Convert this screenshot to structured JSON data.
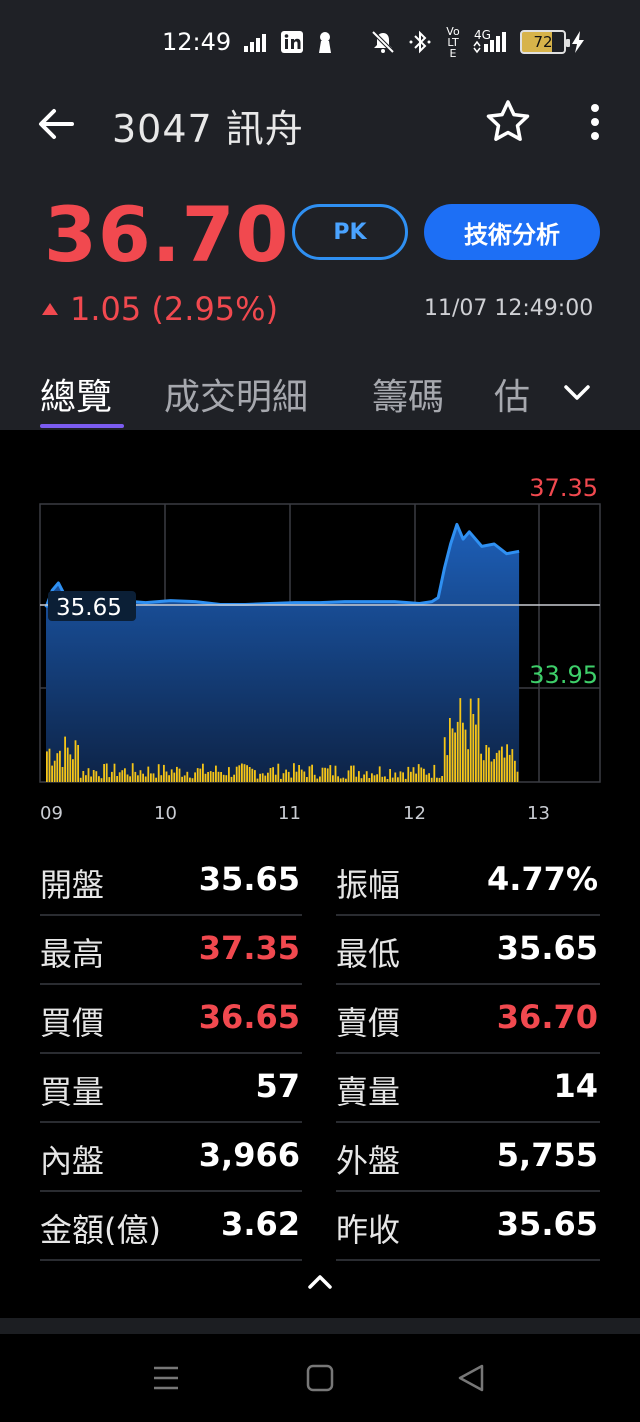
{
  "status_bar": {
    "time": "12:49",
    "battery": "72",
    "network": "4G",
    "volte": "Vo LTE"
  },
  "header": {
    "title": "3047 訊舟"
  },
  "quote": {
    "price": "36.70",
    "pk_label": "PK",
    "tech_label": "技術分析",
    "change": "1.05 (2.95%)",
    "datetime": "11/07 12:49:00"
  },
  "tabs": [
    "總覽",
    "成交明細",
    "籌碼",
    "估"
  ],
  "colors": {
    "up": "#f1494f",
    "down": "#3ecf6a",
    "accent": "#1d6ff5",
    "line": "#2f90f2",
    "volume": "#f5c518",
    "tab_indicator": "#7b5cf0"
  },
  "chart_data": {
    "type": "area",
    "x_ticks": [
      "09",
      "10",
      "11",
      "12",
      "13"
    ],
    "y_high_label": "37.35",
    "y_low_label": "33.95",
    "ref_label": "35.65",
    "ylim": [
      33.95,
      37.35
    ],
    "reference": 35.65,
    "price_series": {
      "x": [
        9.0,
        9.05,
        9.1,
        9.15,
        9.2,
        9.3,
        9.4,
        9.5,
        9.6,
        9.7,
        9.8,
        9.9,
        10.0,
        10.2,
        10.4,
        10.6,
        10.8,
        11.0,
        11.2,
        11.4,
        11.6,
        11.8,
        12.0,
        12.1,
        12.15,
        12.2,
        12.25,
        12.3,
        12.35,
        12.4,
        12.5,
        12.6,
        12.7,
        12.8
      ],
      "y": [
        35.6,
        35.95,
        36.1,
        35.85,
        35.75,
        35.62,
        35.7,
        35.7,
        35.68,
        35.72,
        35.7,
        35.72,
        35.74,
        35.72,
        35.66,
        35.66,
        35.68,
        35.7,
        35.7,
        35.72,
        35.72,
        35.72,
        35.68,
        35.72,
        35.8,
        36.4,
        36.9,
        37.3,
        37.0,
        37.15,
        36.85,
        36.9,
        36.7,
        36.75
      ]
    },
    "volume_note": "intraday volume bars shown in yellow at bottom of chart"
  },
  "stats": [
    {
      "left_label": "開盤",
      "left_value": "35.65",
      "left_color": "white",
      "right_label": "振幅",
      "right_value": "4.77%",
      "right_color": "white"
    },
    {
      "left_label": "最高",
      "left_value": "37.35",
      "left_color": "red",
      "right_label": "最低",
      "right_value": "35.65",
      "right_color": "white"
    },
    {
      "left_label": "買價",
      "left_value": "36.65",
      "left_color": "red",
      "right_label": "賣價",
      "right_value": "36.70",
      "right_color": "red"
    },
    {
      "left_label": "買量",
      "left_value": "57",
      "left_color": "white",
      "right_label": "賣量",
      "right_value": "14",
      "right_color": "white"
    },
    {
      "left_label": "內盤",
      "left_value": "3,966",
      "left_color": "white",
      "right_label": "外盤",
      "right_value": "5,755",
      "right_color": "white"
    },
    {
      "left_label": "金額(億)",
      "left_value": "3.62",
      "left_color": "white",
      "right_label": "昨收",
      "right_value": "35.65",
      "right_color": "white"
    }
  ]
}
